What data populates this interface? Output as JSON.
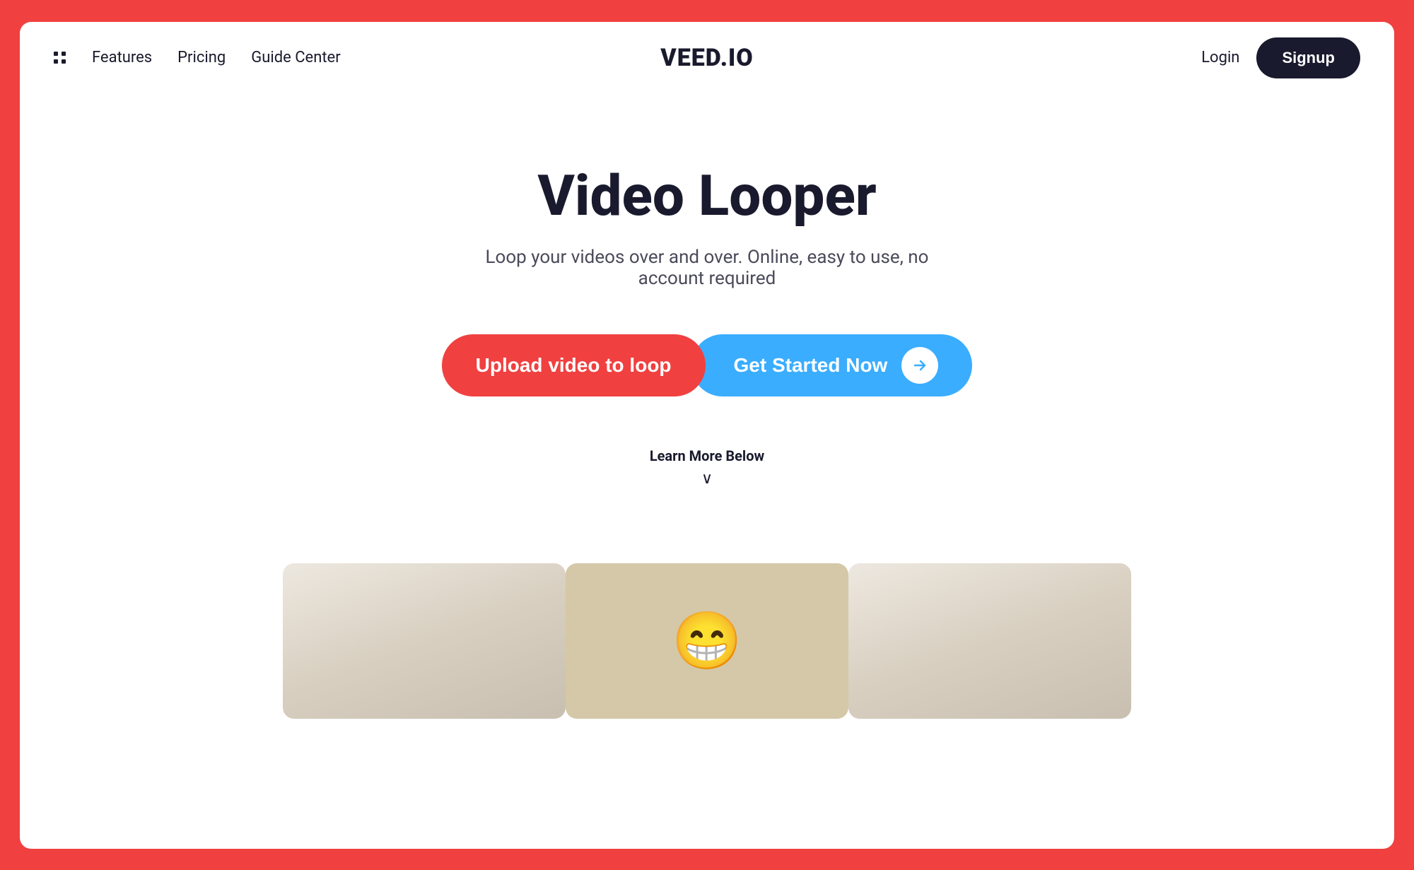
{
  "colors": {
    "background_outer": "#f04040",
    "background_page": "#ffffff",
    "nav_dark": "#1a1a2e",
    "btn_red": "#f04040",
    "btn_blue": "#3aadff"
  },
  "navbar": {
    "grid_icon_label": "grid-menu",
    "features_label": "Features",
    "pricing_label": "Pricing",
    "guide_center_label": "Guide Center",
    "logo_label": "VEED.IO",
    "login_label": "Login",
    "signup_label": "Signup"
  },
  "hero": {
    "title": "Video Looper",
    "subtitle": "Loop your videos over and over. Online, easy to use, no account required",
    "upload_btn": "Upload video to loop",
    "get_started_btn": "Get Started Now",
    "learn_more_label": "Learn More Below",
    "chevron": "∨"
  },
  "thumbnails": [
    {
      "id": "thumb-left",
      "emoji": ""
    },
    {
      "id": "thumb-center",
      "emoji": "😁"
    },
    {
      "id": "thumb-right",
      "emoji": ""
    }
  ]
}
